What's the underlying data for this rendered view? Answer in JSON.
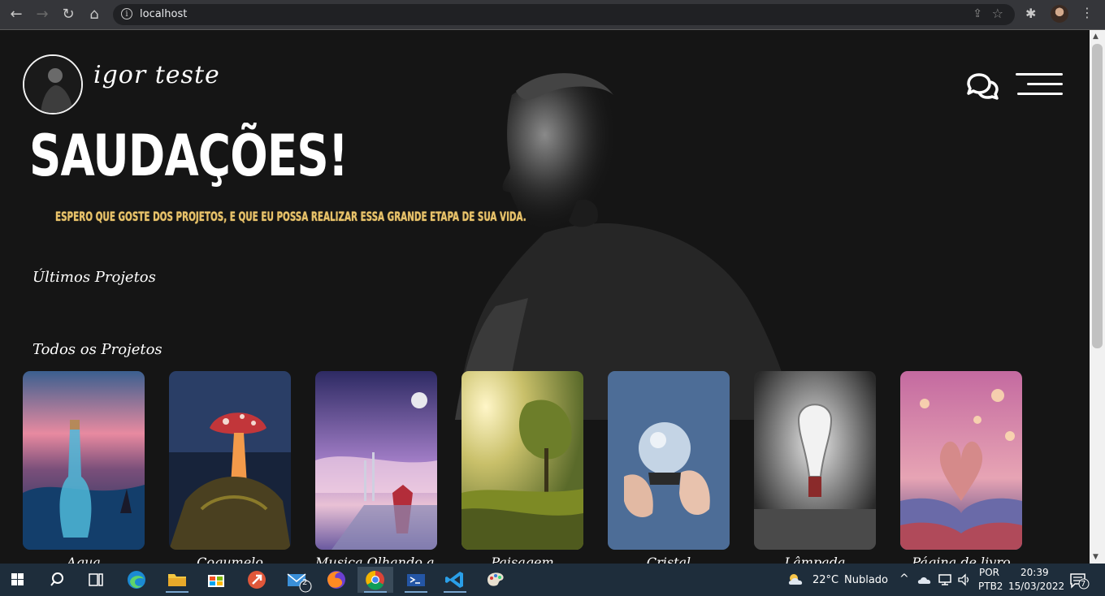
{
  "browser": {
    "url": "localhost"
  },
  "header": {
    "brand_name": "igor teste"
  },
  "hero": {
    "title": "SAUDAÇÕES!",
    "subtitle": "ESPERO QUE GOSTE DOS PROJETOS, E QUE EU POSSA REALIZAR ESSA GRANDE ETAPA DE SUA VIDA."
  },
  "sections": {
    "latest": "Últimos Projetos",
    "all": "Todos os Projetos"
  },
  "projects": [
    {
      "label": "Agua",
      "icon": "bottle-sea-image"
    },
    {
      "label": "Cogumelo",
      "icon": "mushroom-image"
    },
    {
      "label": "Musica Olhando a Lua",
      "icon": "guitarist-moon-image"
    },
    {
      "label": "Paisagem",
      "icon": "landscape-tree-image"
    },
    {
      "label": "Cristal",
      "icon": "crystal-ball-image"
    },
    {
      "label": "Lâmpada",
      "icon": "lightbulb-image"
    },
    {
      "label": "Página de livro",
      "icon": "book-heart-image"
    }
  ],
  "taskbar": {
    "weather_temp": "22°C",
    "weather_desc": "Nublado",
    "mail_badge": "2",
    "lang": "POR",
    "layout": "PTB2",
    "time": "20:39",
    "date": "15/03/2022",
    "notifications": "7"
  }
}
